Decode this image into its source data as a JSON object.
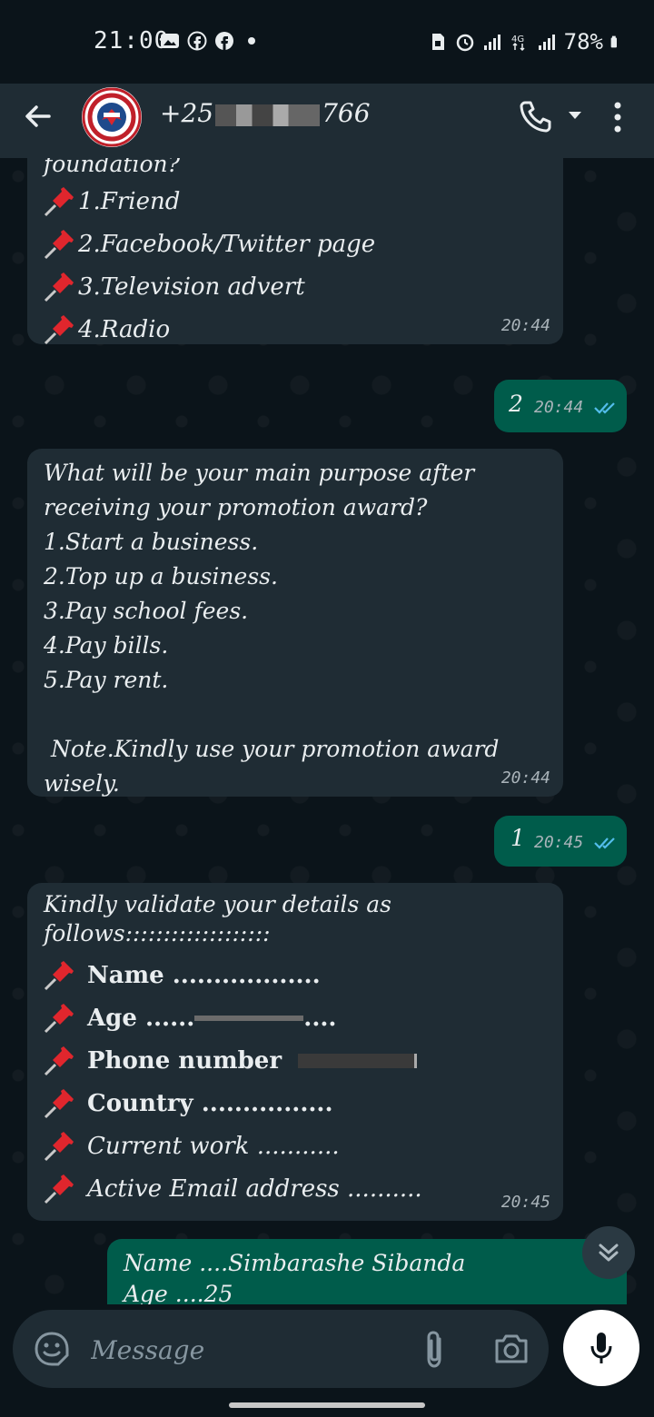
{
  "status_bar": {
    "time": "21:00",
    "battery": "78%"
  },
  "header": {
    "contact_prefix": "+25",
    "contact_suffix": "766"
  },
  "messages": [
    {
      "dir": "in",
      "partial_top": "foundation?",
      "lines": [
        "1.Friend",
        "2.Facebook/Twitter page",
        "3.Television advert",
        "4.Radio"
      ],
      "time": "20:44"
    },
    {
      "dir": "out",
      "text": "2",
      "time": "20:44"
    },
    {
      "dir": "in",
      "text": "What will be your main purpose after\nreceiving your promotion award?\n1.Start a business.\n2.Top up a business.\n3.Pay school fees.\n4.Pay bills.\n5.Pay rent.\n\n Note.Kindly use your promotion award\nwisely.",
      "time": "20:44"
    },
    {
      "dir": "out",
      "text": "1",
      "time": "20:45"
    },
    {
      "dir": "in",
      "intro": "Kindly validate your details as\nfollows:::::::::::::::::::",
      "fields": [
        "Name ..................",
        "Age ......",
        "Phone number",
        "Country ................",
        "Current work ...........",
        "Active Email address .........."
      ],
      "age_suffix": "....",
      "time": "20:45"
    },
    {
      "dir": "out",
      "text": "Name ....Simbarashe Sibanda\nAge ....25"
    }
  ],
  "composer": {
    "placeholder": "Message"
  },
  "colors": {
    "incoming": "#1f2c34",
    "outgoing": "#005c4b",
    "background": "#0b141a",
    "read_tick": "#53bdeb"
  }
}
